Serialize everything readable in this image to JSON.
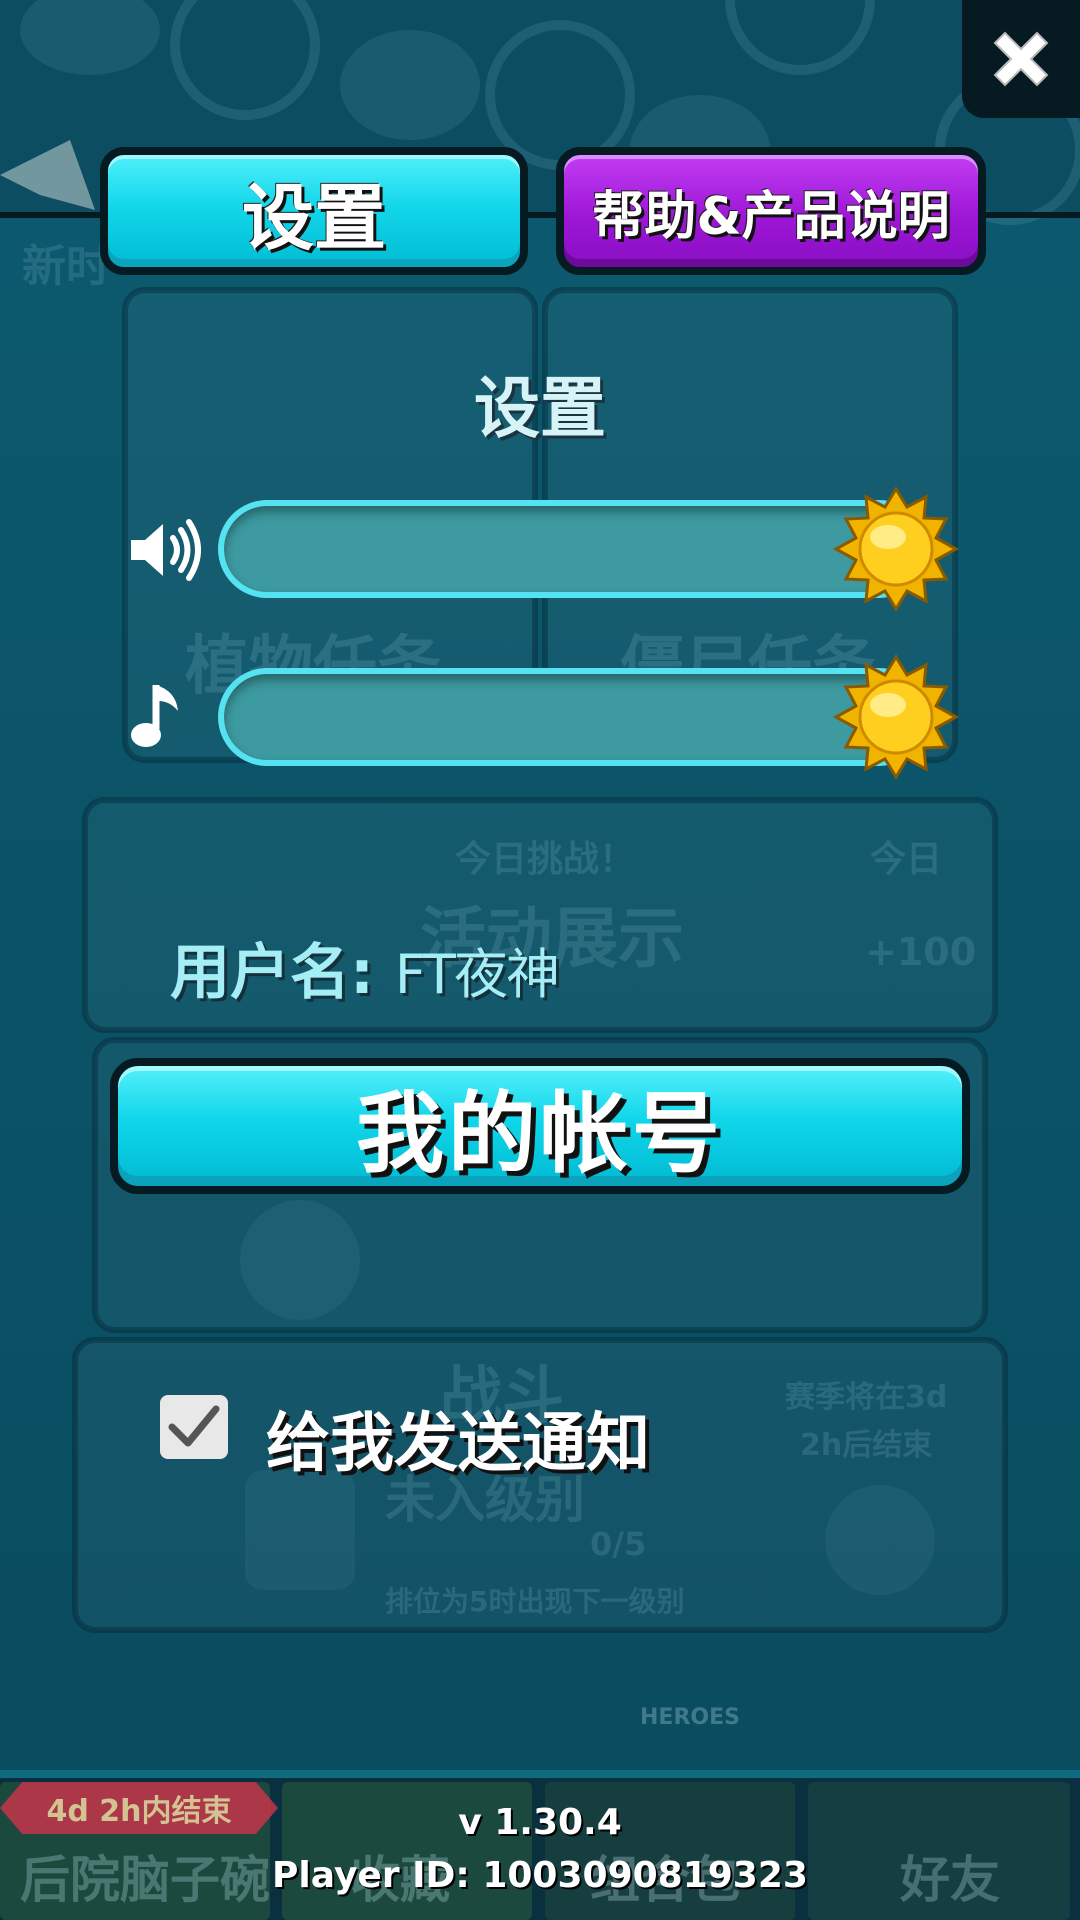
{
  "tabs": {
    "settings_label": "设置",
    "help_label": "帮助&产品说明"
  },
  "panel": {
    "title": "设置"
  },
  "sliders": {
    "sound_volume": 1.0,
    "music_volume": 1.0,
    "sound_icon": "speaker-icon",
    "music_icon": "music-note-icon"
  },
  "account": {
    "username_label": "用户名:",
    "username": "FT夜神",
    "my_account_label": "我的帐号"
  },
  "notifications": {
    "label": "给我发送通知",
    "checked": true
  },
  "footer": {
    "version": "v 1.30.4",
    "player_id": "Player ID: 1003090819323"
  },
  "background": {
    "new_label": "新时",
    "plant_quest": "植物任务",
    "zombie_quest": "僵尸任务",
    "today_challenge": "今日挑战！",
    "today": "今日",
    "event_showcase": "活动展示",
    "reward": "+100",
    "season_end": "赛季将在3d",
    "season_end_2": "2h后结束",
    "battle": "战斗",
    "unranked": "未入级别",
    "progress": "0/5",
    "rank_hint": "排位为5时出现下一级别",
    "timer": "4d 2h内结束",
    "nav_brain_bowl": "后院脑子碗",
    "nav_collection": "收藏",
    "nav_packs": "组合包",
    "nav_friends": "好友",
    "heroes_card": "HEROES"
  },
  "colors": {
    "accent_cyan": "#14d7ea",
    "accent_purple": "#9d17d6",
    "panel_bg": "#0b5266"
  }
}
